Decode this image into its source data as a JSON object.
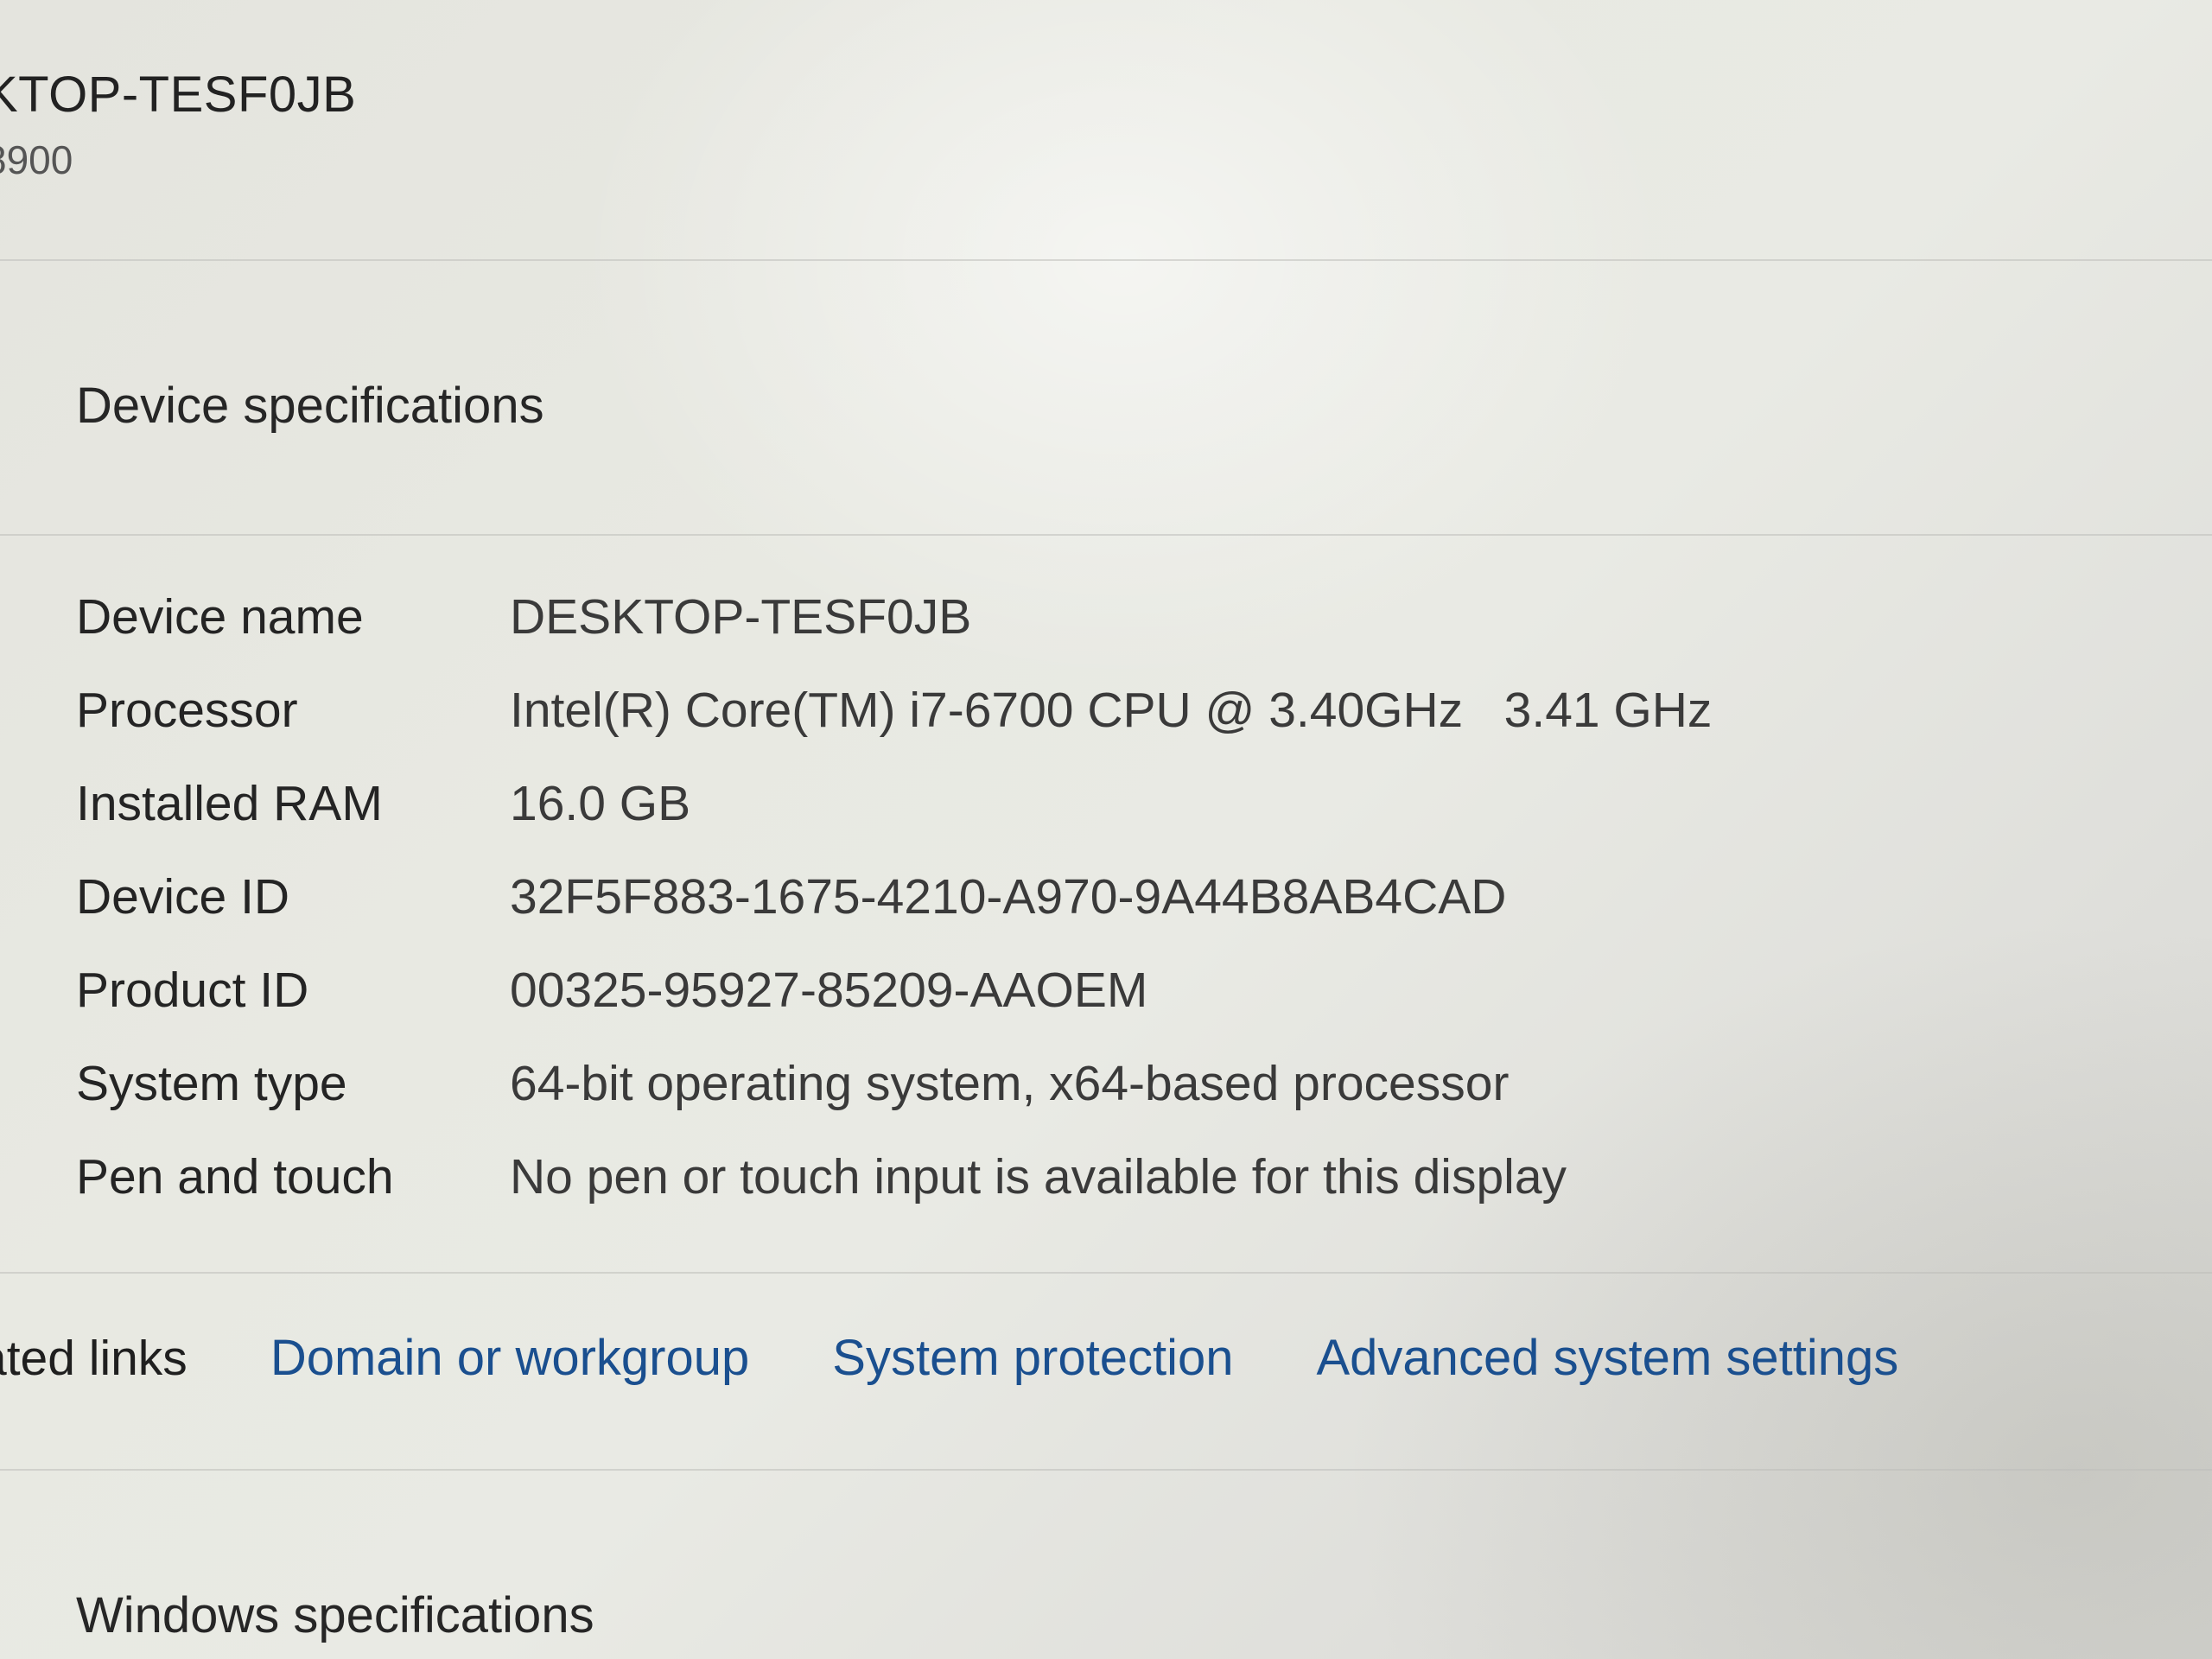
{
  "header": {
    "device_name_partial": "KTOP-TESF0JB",
    "model_partial": "8900"
  },
  "device_specifications": {
    "title": "Device specifications",
    "rows": [
      {
        "label": "Device name",
        "value": "DESKTOP-TESF0JB"
      },
      {
        "label": "Processor",
        "value": "Intel(R) Core(TM) i7-6700 CPU @ 3.40GHz   3.41 GHz"
      },
      {
        "label": "Installed RAM",
        "value": "16.0 GB"
      },
      {
        "label": "Device ID",
        "value": "32F5F883-1675-4210-A970-9A44B8AB4CAD"
      },
      {
        "label": "Product ID",
        "value": "00325-95927-85209-AAOEM"
      },
      {
        "label": "System type",
        "value": "64-bit operating system, x64-based processor"
      },
      {
        "label": "Pen and touch",
        "value": "No pen or touch input is available for this display"
      }
    ]
  },
  "related_links": {
    "label_partial": "ated links",
    "links": [
      "Domain or workgroup",
      "System protection",
      "Advanced system settings"
    ]
  },
  "windows_specifications": {
    "title": "Windows specifications"
  },
  "colors": {
    "link": "#1a4f8f",
    "text": "#242424"
  }
}
